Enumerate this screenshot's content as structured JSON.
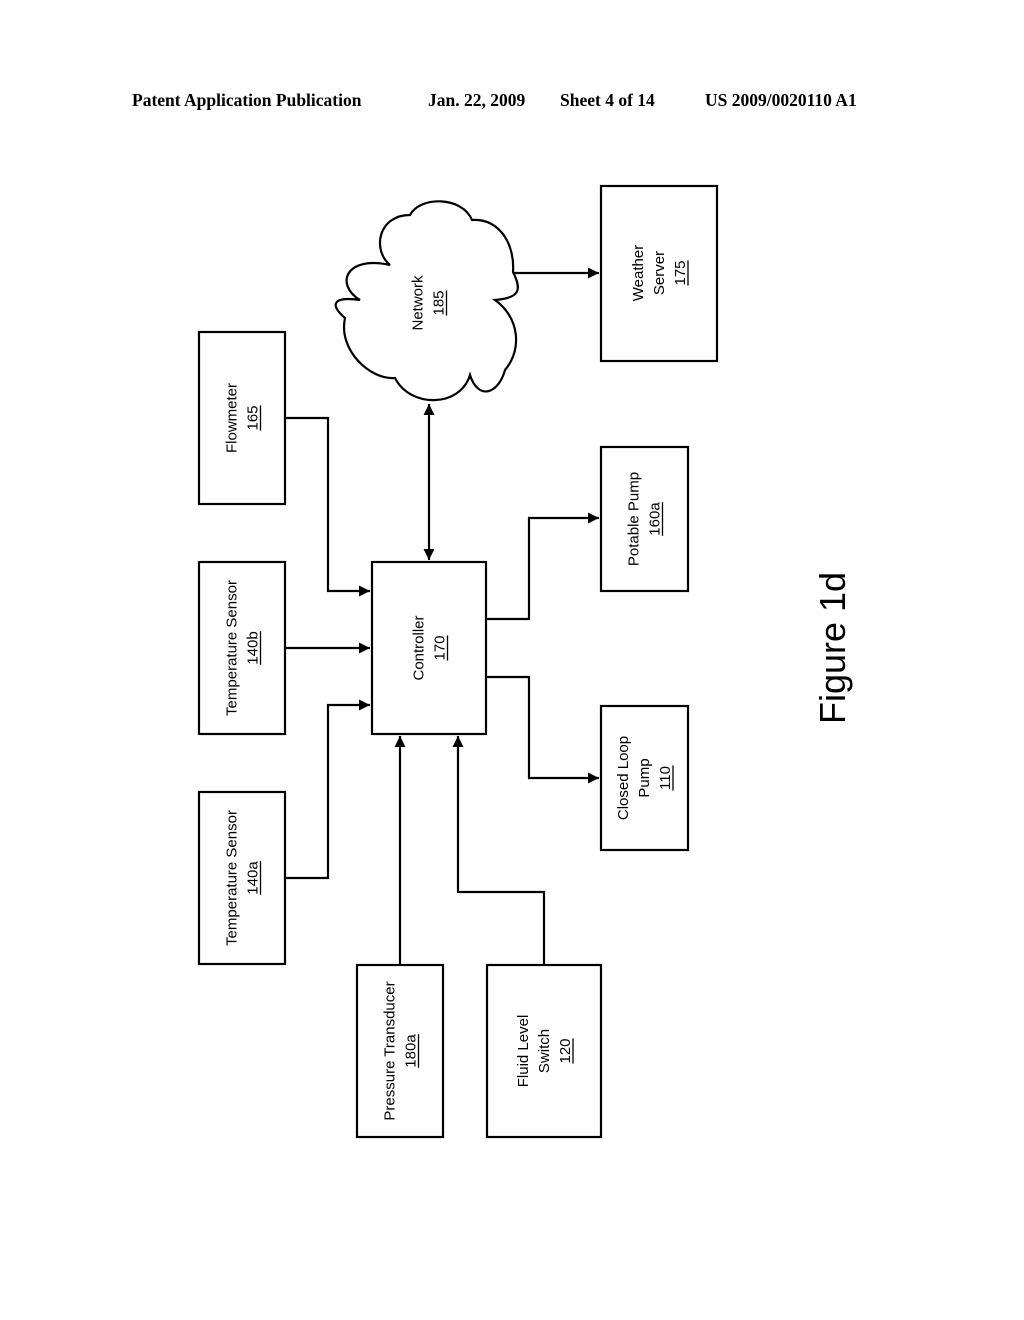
{
  "header": {
    "publication": "Patent Application Publication",
    "date": "Jan. 22, 2009",
    "sheet": "Sheet 4 of 14",
    "number": "US 2009/0020110 A1"
  },
  "figure_label": "Figure 1d",
  "orientation": "rotated 90° counter-clockwise",
  "nodes": {
    "flowmeter": {
      "lines": [
        "Flowmeter"
      ],
      "ref": "165"
    },
    "temp_b": {
      "lines": [
        "Temperature Sensor"
      ],
      "ref": "140b"
    },
    "temp_a": {
      "lines": [
        "Temperature Sensor"
      ],
      "ref": "140a"
    },
    "controller": {
      "lines": [
        "Controller"
      ],
      "ref": "170"
    },
    "network": {
      "lines": [
        "Network"
      ],
      "ref": "185",
      "shape": "cloud"
    },
    "weather": {
      "lines": [
        "Weather",
        "Server"
      ],
      "ref": "175"
    },
    "potable": {
      "lines": [
        "Potable Pump"
      ],
      "ref": "160a"
    },
    "closed_loop": {
      "lines": [
        "Closed Loop",
        "Pump"
      ],
      "ref": "110"
    },
    "pressure": {
      "lines": [
        "Pressure Transducer"
      ],
      "ref": "180a"
    },
    "fluid_level": {
      "lines": [
        "Fluid Level",
        "Switch"
      ],
      "ref": "120"
    }
  },
  "edges": [
    {
      "from": "flowmeter",
      "to": "controller",
      "direction": "one-way"
    },
    {
      "from": "temp_b",
      "to": "controller",
      "direction": "one-way"
    },
    {
      "from": "temp_a",
      "to": "controller",
      "direction": "one-way"
    },
    {
      "from": "pressure",
      "to": "controller",
      "direction": "one-way"
    },
    {
      "from": "fluid_level",
      "to": "controller",
      "direction": "one-way"
    },
    {
      "from": "controller",
      "to": "network",
      "direction": "bidirectional"
    },
    {
      "from": "network",
      "to": "weather",
      "direction": "one-way"
    },
    {
      "from": "controller",
      "to": "potable",
      "direction": "one-way"
    },
    {
      "from": "controller",
      "to": "closed_loop",
      "direction": "one-way"
    }
  ]
}
